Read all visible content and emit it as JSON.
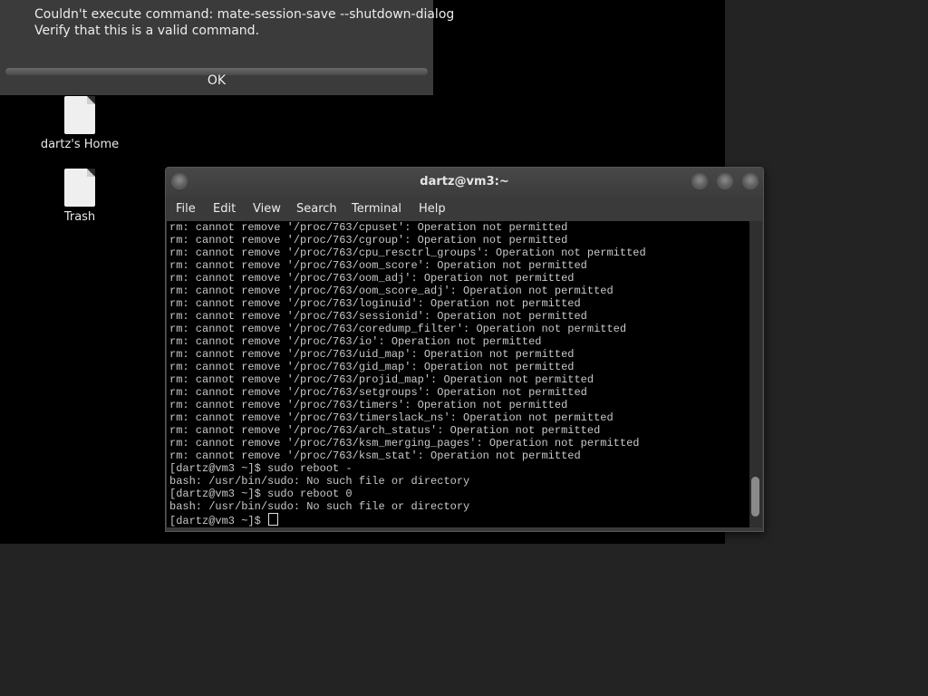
{
  "dialog": {
    "message_line1": "Couldn't execute command: mate-session-save --shutdown-dialog",
    "message_line2": "Verify that this is a valid command.",
    "ok_label": "OK"
  },
  "desktop_icons": [
    {
      "label": "dartz's Home",
      "icon": "file-icon"
    },
    {
      "label": "Trash",
      "icon": "file-icon"
    }
  ],
  "terminal": {
    "title": "dartz@vm3:~",
    "menu": [
      "File",
      "Edit",
      "View",
      "Search",
      "Terminal",
      "Help"
    ],
    "lines": [
      "rm: cannot remove '/proc/763/cpuset': Operation not permitted",
      "rm: cannot remove '/proc/763/cgroup': Operation not permitted",
      "rm: cannot remove '/proc/763/cpu_resctrl_groups': Operation not permitted",
      "rm: cannot remove '/proc/763/oom_score': Operation not permitted",
      "rm: cannot remove '/proc/763/oom_adj': Operation not permitted",
      "rm: cannot remove '/proc/763/oom_score_adj': Operation not permitted",
      "rm: cannot remove '/proc/763/loginuid': Operation not permitted",
      "rm: cannot remove '/proc/763/sessionid': Operation not permitted",
      "rm: cannot remove '/proc/763/coredump_filter': Operation not permitted",
      "rm: cannot remove '/proc/763/io': Operation not permitted",
      "rm: cannot remove '/proc/763/uid_map': Operation not permitted",
      "rm: cannot remove '/proc/763/gid_map': Operation not permitted",
      "rm: cannot remove '/proc/763/projid_map': Operation not permitted",
      "rm: cannot remove '/proc/763/setgroups': Operation not permitted",
      "rm: cannot remove '/proc/763/timers': Operation not permitted",
      "rm: cannot remove '/proc/763/timerslack_ns': Operation not permitted",
      "rm: cannot remove '/proc/763/arch_status': Operation not permitted",
      "rm: cannot remove '/proc/763/ksm_merging_pages': Operation not permitted",
      "rm: cannot remove '/proc/763/ksm_stat': Operation not permitted",
      "[dartz@vm3 ~]$ sudo reboot -",
      "bash: /usr/bin/sudo: No such file or directory",
      "[dartz@vm3 ~]$ sudo reboot 0",
      "bash: /usr/bin/sudo: No such file or directory"
    ],
    "prompt": "[dartz@vm3 ~]$ "
  }
}
